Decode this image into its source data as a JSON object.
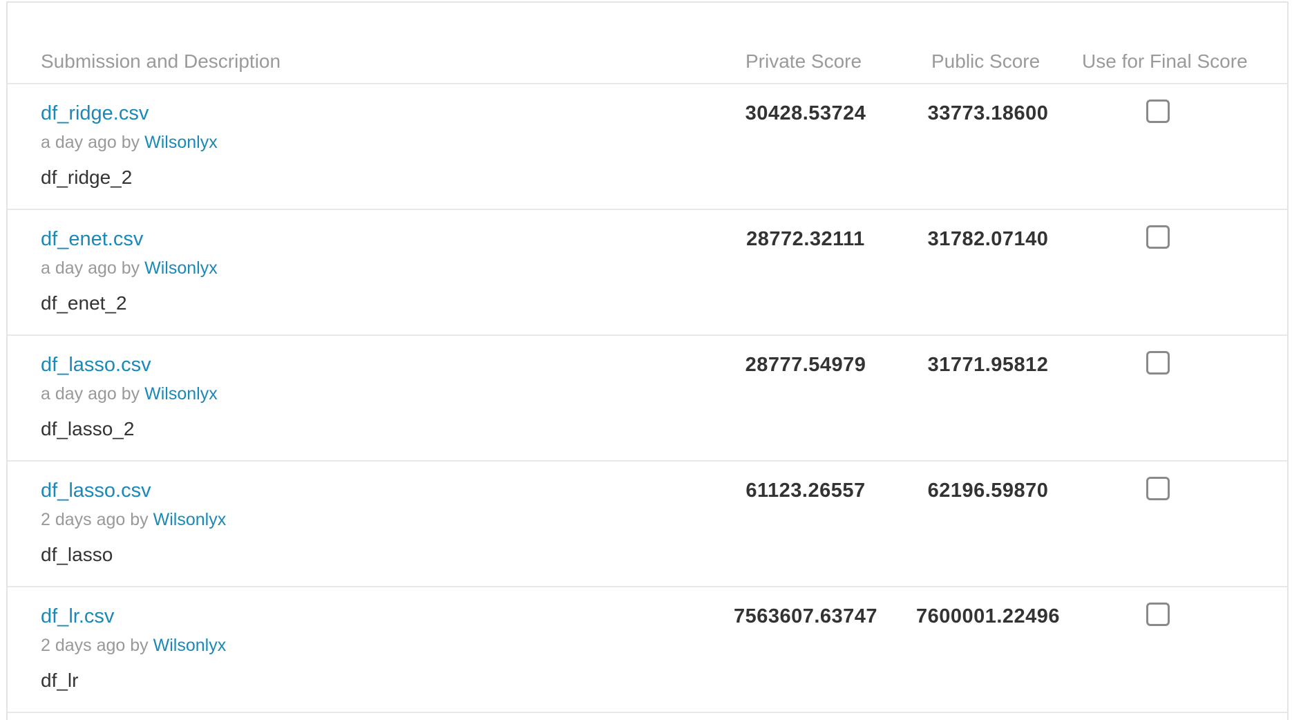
{
  "columns": {
    "submission": "Submission and Description",
    "private": "Private Score",
    "public": "Public Score",
    "final": "Use for Final Score"
  },
  "rows": [
    {
      "file": "df_ridge.csv",
      "time": "a day ago",
      "by": "by",
      "user": "Wilsonlyx",
      "description": "df_ridge_2",
      "private_score": "30428.53724",
      "public_score": "33773.18600",
      "use_for_final": false
    },
    {
      "file": "df_enet.csv",
      "time": "a day ago",
      "by": "by",
      "user": "Wilsonlyx",
      "description": "df_enet_2",
      "private_score": "28772.32111",
      "public_score": "31782.07140",
      "use_for_final": false
    },
    {
      "file": "df_lasso.csv",
      "time": "a day ago",
      "by": "by",
      "user": "Wilsonlyx",
      "description": "df_lasso_2",
      "private_score": "28777.54979",
      "public_score": "31771.95812",
      "use_for_final": false
    },
    {
      "file": "df_lasso.csv",
      "time": "2 days ago",
      "by": "by",
      "user": "Wilsonlyx",
      "description": "df_lasso",
      "private_score": "61123.26557",
      "public_score": "62196.59870",
      "use_for_final": false
    },
    {
      "file": "df_lr.csv",
      "time": "2 days ago",
      "by": "by",
      "user": "Wilsonlyx",
      "description": "df_lr",
      "private_score": "7563607.63747",
      "public_score": "7600001.22496",
      "use_for_final": false
    }
  ]
}
